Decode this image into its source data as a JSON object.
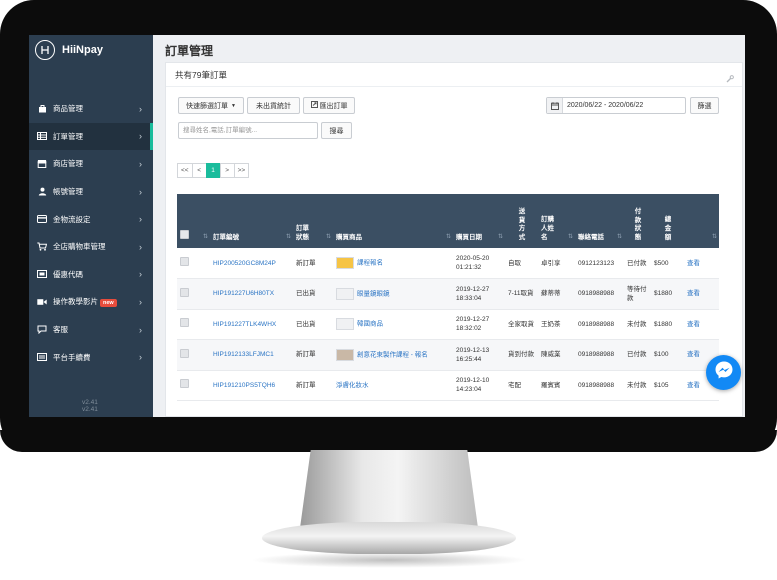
{
  "brand": {
    "name": "HiiNpay"
  },
  "sidebar": {
    "items": [
      {
        "label": "商品管理",
        "icon": "bag-icon"
      },
      {
        "label": "訂單管理",
        "icon": "table-icon"
      },
      {
        "label": "商店管理",
        "icon": "store-icon"
      },
      {
        "label": "帳號管理",
        "icon": "user-icon"
      },
      {
        "label": "金物流設定",
        "icon": "card-icon"
      },
      {
        "label": "全店購物車管理",
        "icon": "cart-icon"
      },
      {
        "label": "優惠代碼",
        "icon": "ticket-icon"
      },
      {
        "label": "操作教學影片",
        "icon": "video-icon",
        "badge": "new"
      },
      {
        "label": "客服",
        "icon": "chat-icon"
      },
      {
        "label": "平台手續費",
        "icon": "receipt-icon"
      }
    ],
    "version_lines": [
      "v2.41",
      "v2.41"
    ]
  },
  "page": {
    "title": "訂單管理"
  },
  "panel": {
    "header": "共有79筆訂單",
    "toolbar": {
      "quick_select_label": "快速篩選訂單",
      "unshipped_stats_label": "未出貨統計",
      "export_label": "匯出訂單",
      "date_range": "2020/06/22 - 2020/06/22",
      "apply_label": "篩選",
      "search_placeholder": "搜尋姓名,電話,訂單編號...",
      "search_button": "搜尋"
    },
    "pagination": {
      "first": "<<",
      "prev": "<",
      "current": "1",
      "next": ">",
      "last": ">>"
    }
  },
  "table": {
    "headers": {
      "order_no": "訂單編號",
      "status": [
        "訂單",
        "狀態"
      ],
      "product": "購買商品",
      "date": "購買日期",
      "delivery": [
        "送",
        "貨",
        "方",
        "式"
      ],
      "buyer": [
        "訂購",
        "人姓",
        "名"
      ],
      "phone": "聯絡電話",
      "payment": [
        "付",
        "款",
        "狀",
        "態"
      ],
      "total": [
        "總",
        "金",
        "額"
      ]
    },
    "rows": [
      {
        "order_no": "HIP200520GC8M24P",
        "status": "新訂單",
        "product": "課程報名",
        "date": "2020-05-20",
        "time": "01:21:32",
        "delivery": "自取",
        "buyer": "卓引享",
        "phone": "0912123123",
        "payment": "已付款",
        "total": "$500",
        "action": "查看"
      },
      {
        "order_no": "HIP191227U6H80TX",
        "status": "已出貨",
        "product": "眼量鏡眼鏡",
        "date": "2019-12-27",
        "time": "18:33:04",
        "delivery": "7-11取貨",
        "buyer": "蘇蒂蒂",
        "phone": "0918988988",
        "payment": "等待付款",
        "total": "$1880",
        "action": "查看"
      },
      {
        "order_no": "HIP191227TLK4WHX",
        "status": "已出貨",
        "product": "韓國商品",
        "date": "2019-12-27",
        "time": "18:32:02",
        "delivery": "全家取貨",
        "buyer": "王奶茶",
        "phone": "0918988988",
        "payment": "未付款",
        "total": "$1880",
        "action": "查看"
      },
      {
        "order_no": "HIP1912133LFJMC1",
        "status": "新訂單",
        "product": "創意花束製作課程 - 報名",
        "date": "2019-12-13",
        "time": "16:25:44",
        "delivery": "貨到付款",
        "buyer": "陳威業",
        "phone": "0918988988",
        "payment": "已付款",
        "total": "$100",
        "action": "查看"
      },
      {
        "order_no": "HIP191210PS5TQH6",
        "status": "新訂單",
        "product": "淨膚化妝水",
        "date": "2019-12-10",
        "time": "14:23:04",
        "delivery": "宅配",
        "buyer": "羅賓賓",
        "phone": "0918988988",
        "payment": "未付款",
        "total": "$105",
        "action": "查看"
      }
    ]
  }
}
